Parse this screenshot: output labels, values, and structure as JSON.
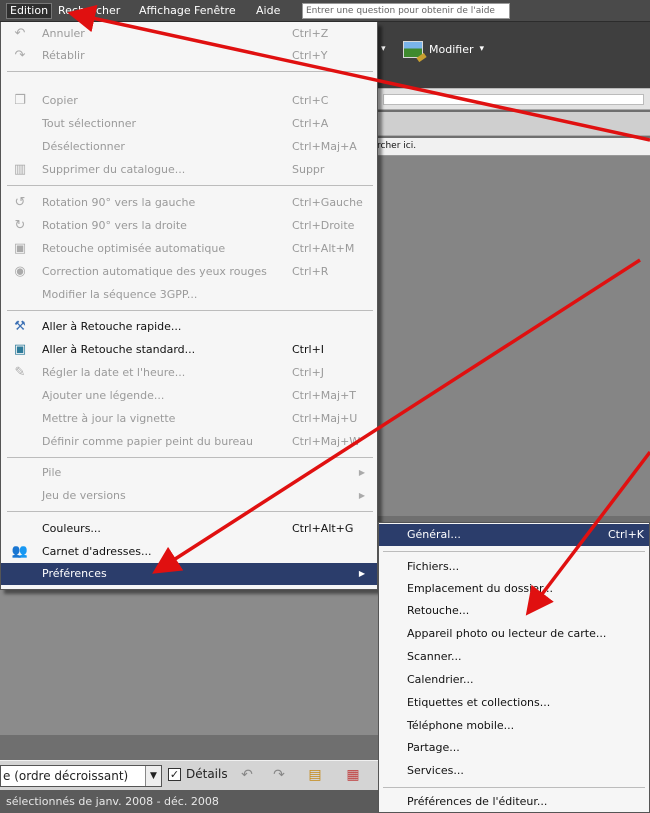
{
  "menubar": {
    "items": [
      "Edition",
      "Rechercher",
      "Affichage",
      "Fenêtre",
      "Aide"
    ],
    "help_placeholder": "Entrer une question pour obtenir de l'aide"
  },
  "toolbar": {
    "modify_label": "Modifier",
    "dropdown_arrow": "▾"
  },
  "search_hint": "rcher ici.",
  "edit_menu": {
    "items": [
      {
        "label": "Annuler",
        "shortcut": "Ctrl+Z",
        "icon": "undo-icon",
        "enabled": false
      },
      {
        "label": "Rétablir",
        "shortcut": "Ctrl+Y",
        "icon": "redo-icon",
        "enabled": false
      },
      {
        "label": "Copier",
        "shortcut": "Ctrl+C",
        "icon": "copy-icon",
        "enabled": false
      },
      {
        "label": "Tout sélectionner",
        "shortcut": "Ctrl+A",
        "icon": "",
        "enabled": false
      },
      {
        "label": "Désélectionner",
        "shortcut": "Ctrl+Maj+A",
        "icon": "",
        "enabled": false
      },
      {
        "label": "Supprimer du catalogue...",
        "shortcut": "Suppr",
        "icon": "trash-icon",
        "enabled": false
      },
      {
        "label": "Rotation 90° vers la gauche",
        "shortcut": "Ctrl+Gauche",
        "icon": "rotate-left-icon",
        "enabled": false
      },
      {
        "label": "Rotation 90° vers la droite",
        "shortcut": "Ctrl+Droite",
        "icon": "rotate-right-icon",
        "enabled": false
      },
      {
        "label": "Retouche optimisée automatique",
        "shortcut": "Ctrl+Alt+M",
        "icon": "auto-fix-icon",
        "enabled": false
      },
      {
        "label": "Correction automatique des yeux rouges",
        "shortcut": "Ctrl+R",
        "icon": "red-eye-icon",
        "enabled": false
      },
      {
        "label": "Modifier la séquence 3GPP...",
        "shortcut": "",
        "icon": "",
        "enabled": false
      },
      {
        "label": "Aller à Retouche rapide...",
        "shortcut": "",
        "icon": "quick-fix-icon",
        "enabled": true
      },
      {
        "label": "Aller à Retouche standard...",
        "shortcut": "Ctrl+I",
        "icon": "standard-edit-icon",
        "enabled": true
      },
      {
        "label": "Régler la date et l'heure...",
        "shortcut": "Ctrl+J",
        "icon": "date-time-icon",
        "enabled": false
      },
      {
        "label": "Ajouter une légende...",
        "shortcut": "Ctrl+Maj+T",
        "icon": "",
        "enabled": false
      },
      {
        "label": "Mettre à jour la vignette",
        "shortcut": "Ctrl+Maj+U",
        "icon": "",
        "enabled": false
      },
      {
        "label": "Définir comme papier peint du bureau",
        "shortcut": "Ctrl+Maj+W",
        "icon": "",
        "enabled": false
      },
      {
        "label": "Pile",
        "shortcut": "",
        "icon": "",
        "enabled": false,
        "submenu": true
      },
      {
        "label": "Jeu de versions",
        "shortcut": "",
        "icon": "",
        "enabled": false,
        "submenu": true
      },
      {
        "label": "Couleurs...",
        "shortcut": "Ctrl+Alt+G",
        "icon": "",
        "enabled": true
      },
      {
        "label": "Carnet d'adresses...",
        "shortcut": "",
        "icon": "address-book-icon",
        "enabled": true
      },
      {
        "label": "Préférences",
        "shortcut": "",
        "icon": "",
        "enabled": true,
        "submenu": true,
        "highlighted": true
      }
    ],
    "submenu_arrow": "▶"
  },
  "preferences_menu": {
    "items": [
      {
        "label": "Général...",
        "shortcut": "Ctrl+K",
        "highlighted": true
      },
      {
        "label": "Fichiers..."
      },
      {
        "label": "Emplacement du dossier..."
      },
      {
        "label": "Retouche..."
      },
      {
        "label": "Appareil photo ou lecteur de carte..."
      },
      {
        "label": "Scanner..."
      },
      {
        "label": "Calendrier..."
      },
      {
        "label": "Etiquettes et collections..."
      },
      {
        "label": "Téléphone mobile..."
      },
      {
        "label": "Partage..."
      },
      {
        "label": "Services..."
      },
      {
        "label": "Préférences de l'éditeur..."
      }
    ]
  },
  "bottom_bar": {
    "sort_value": "e (ordre décroissant)",
    "details_label": "Détails",
    "details_checked": "✓"
  },
  "status_bar": {
    "text": "sélectionnés de janv. 2008 - déc. 2008"
  },
  "colors": {
    "menu_highlight": "#2b3d6b",
    "annotation_arrow": "#e01010",
    "menubar": "#4a4a4a"
  }
}
